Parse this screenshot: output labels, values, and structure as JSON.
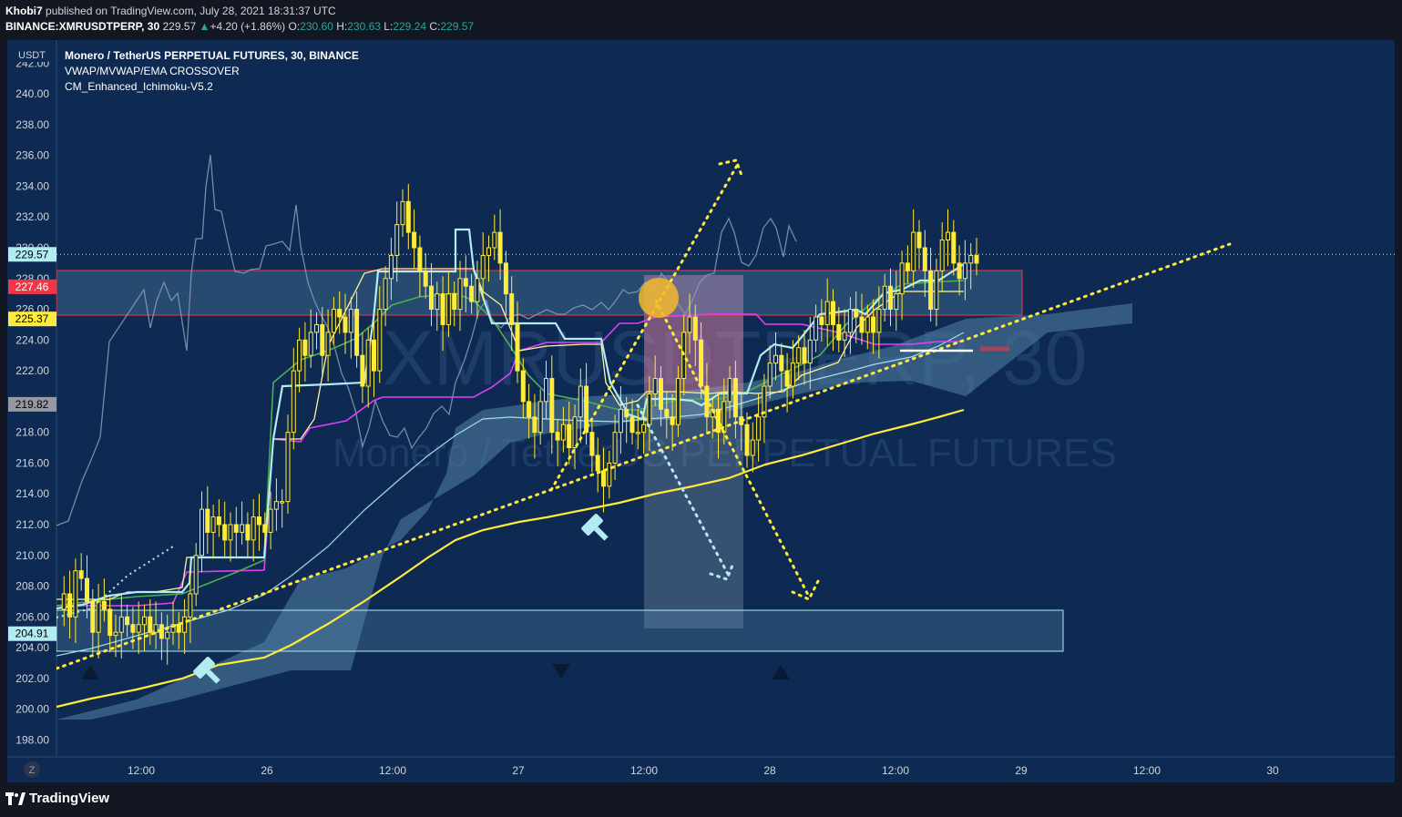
{
  "header": {
    "author": "Khobi7",
    "published_text": "published on TradingView.com, July 28, 2021 18:31:37 UTC",
    "symbol": "BINANCE:XMRUSDTPERP, 30",
    "last_price": "229.57",
    "change_arrow": "▲",
    "change": "+4.20 (+1.86%)",
    "open_label": "O:",
    "open": "230.60",
    "high_label": "H:",
    "high": "230.63",
    "low_label": "L:",
    "low": "229.24",
    "close_label": "C:",
    "close": "229.57"
  },
  "legend": {
    "title": "Monero / TetherUS PERPETUAL FUTURES, 30, BINANCE",
    "indicator_1": "VWAP/MVWAP/EMA CROSSOVER",
    "indicator_2": "CM_Enhanced_Ichimoku-V5.2"
  },
  "watermark": {
    "symbol": "XMRUSDTPERP, 30",
    "name": "Monero / TetherUS PERPETUAL FUTURES"
  },
  "price_axis": {
    "currency": "USDT",
    "tick_labels": [
      "198.00",
      "200.00",
      "202.00",
      "204.00",
      "206.00",
      "208.00",
      "210.00",
      "212.00",
      "214.00",
      "216.00",
      "218.00",
      "220.00",
      "222.00",
      "224.00",
      "226.00",
      "228.00",
      "230.00",
      "232.00",
      "234.00",
      "236.00",
      "238.00",
      "240.00",
      "242.00"
    ],
    "badges": [
      {
        "label": "229.57",
        "value": 229.57,
        "bg": "#b2ebf2",
        "fg": "#000000"
      },
      {
        "label": "227.46",
        "value": 227.46,
        "bg": "#f23645",
        "fg": "#ffffff"
      },
      {
        "label": "225.37",
        "value": 225.37,
        "bg": "#ffeb3b",
        "fg": "#000000"
      },
      {
        "label": "219.82",
        "value": 219.82,
        "bg": "#9598a1",
        "fg": "#000000"
      },
      {
        "label": "204.91",
        "value": 204.91,
        "bg": "#b2ebf2",
        "fg": "#000000"
      }
    ]
  },
  "time_axis": {
    "labels": [
      "12:00",
      "26",
      "12:00",
      "27",
      "12:00",
      "28",
      "12:00",
      "29",
      "12:00",
      "30"
    ],
    "goto_button": "Z"
  },
  "footer": {
    "brand": "TradingView"
  },
  "colors": {
    "background": "#0e2a52",
    "candle": "#ffeb3b",
    "cyan_line": "#b2ebf2",
    "green_line": "#4caf50",
    "purple_line": "#e040fb",
    "ema_yellow": "#ffeb3b",
    "cloud": "#4f7c9e",
    "zone_red": "#f23645"
  },
  "chart_data": {
    "type": "candlestick",
    "title": "Monero / TetherUS PERPETUAL FUTURES, 30, BINANCE",
    "ylabel": "USDT",
    "ylim": [
      196.9,
      243.5
    ],
    "last_price": 229.57,
    "price_path": [
      [
        0,
        206.5
      ],
      [
        6,
        207.5
      ],
      [
        12,
        206
      ],
      [
        18,
        209
      ],
      [
        24,
        208.5
      ],
      [
        30,
        207
      ],
      [
        36,
        205
      ],
      [
        42,
        207
      ],
      [
        48,
        206.5
      ],
      [
        54,
        204.8
      ],
      [
        60,
        205
      ],
      [
        66,
        206
      ],
      [
        72,
        205.5
      ],
      [
        78,
        205
      ],
      [
        84,
        205.5
      ],
      [
        90,
        206
      ],
      [
        96,
        205
      ],
      [
        102,
        205.5
      ],
      [
        108,
        204.6
      ],
      [
        114,
        205
      ],
      [
        120,
        205.5
      ],
      [
        126,
        205
      ],
      [
        132,
        206
      ],
      [
        138,
        207.5
      ],
      [
        144,
        210
      ],
      [
        150,
        213
      ],
      [
        156,
        211.5
      ],
      [
        162,
        212.5
      ],
      [
        168,
        212
      ],
      [
        174,
        211
      ],
      [
        180,
        212
      ],
      [
        186,
        211.5
      ],
      [
        192,
        212
      ],
      [
        198,
        211
      ],
      [
        204,
        212.5
      ],
      [
        210,
        212
      ],
      [
        216,
        211.5
      ],
      [
        222,
        213
      ],
      [
        228,
        213.5
      ],
      [
        234,
        213.5
      ],
      [
        240,
        218
      ],
      [
        246,
        222
      ],
      [
        252,
        224
      ],
      [
        258,
        223
      ],
      [
        264,
        224.5
      ],
      [
        270,
        225
      ],
      [
        276,
        223
      ],
      [
        282,
        224.5
      ],
      [
        288,
        226
      ],
      [
        294,
        225.5
      ],
      [
        300,
        224.5
      ],
      [
        306,
        226
      ],
      [
        312,
        223
      ],
      [
        318,
        221
      ],
      [
        324,
        224
      ],
      [
        330,
        222
      ],
      [
        336,
        226
      ],
      [
        342,
        228
      ],
      [
        348,
        229.5
      ],
      [
        354,
        231.5
      ],
      [
        360,
        233
      ],
      [
        366,
        231
      ],
      [
        372,
        230
      ],
      [
        378,
        228.5
      ],
      [
        384,
        227.5
      ],
      [
        390,
        226
      ],
      [
        396,
        227
      ],
      [
        402,
        225
      ],
      [
        408,
        227
      ],
      [
        414,
        226
      ],
      [
        420,
        228
      ],
      [
        426,
        227.5
      ],
      [
        432,
        226.5
      ],
      [
        438,
        228
      ],
      [
        444,
        229.5
      ],
      [
        450,
        230
      ],
      [
        456,
        231
      ],
      [
        462,
        229
      ],
      [
        468,
        227
      ],
      [
        474,
        225
      ],
      [
        480,
        222
      ],
      [
        486,
        220
      ],
      [
        492,
        219
      ],
      [
        498,
        218
      ],
      [
        504,
        220
      ],
      [
        510,
        221.5
      ],
      [
        516,
        218
      ],
      [
        522,
        217.5
      ],
      [
        528,
        218.5
      ],
      [
        534,
        217
      ],
      [
        540,
        219
      ],
      [
        546,
        221
      ],
      [
        552,
        218
      ],
      [
        558,
        216.5
      ],
      [
        564,
        215.5
      ],
      [
        570,
        214.5
      ],
      [
        576,
        216
      ],
      [
        582,
        218
      ],
      [
        588,
        219.5
      ],
      [
        594,
        219
      ],
      [
        600,
        218
      ],
      [
        606,
        218
      ],
      [
        612,
        218.5
      ],
      [
        618,
        220.5
      ],
      [
        624,
        221.5
      ],
      [
        630,
        219.5
      ],
      [
        636,
        219
      ],
      [
        642,
        218.5
      ],
      [
        648,
        221.5
      ],
      [
        654,
        224.5
      ],
      [
        660,
        225.5
      ],
      [
        666,
        224
      ],
      [
        672,
        221
      ],
      [
        678,
        219
      ],
      [
        684,
        219.5
      ],
      [
        690,
        218
      ],
      [
        696,
        220
      ],
      [
        702,
        221.5
      ],
      [
        708,
        219
      ],
      [
        714,
        218.5
      ],
      [
        720,
        216.5
      ],
      [
        726,
        217.5
      ],
      [
        732,
        219
      ],
      [
        738,
        221
      ],
      [
        744,
        222.5
      ],
      [
        750,
        223
      ],
      [
        756,
        222
      ],
      [
        762,
        221
      ],
      [
        768,
        222.5
      ],
      [
        774,
        223.5
      ],
      [
        780,
        222.5
      ],
      [
        786,
        224
      ],
      [
        792,
        225.5
      ],
      [
        798,
        225
      ],
      [
        804,
        226.5
      ],
      [
        810,
        225
      ],
      [
        816,
        224
      ],
      [
        822,
        224.5
      ],
      [
        828,
        226
      ],
      [
        834,
        225.5
      ],
      [
        840,
        224.5
      ],
      [
        846,
        225.5
      ],
      [
        852,
        224.5
      ],
      [
        858,
        226
      ],
      [
        864,
        227.5
      ],
      [
        870,
        226
      ],
      [
        876,
        227
      ],
      [
        882,
        229
      ],
      [
        888,
        228.5
      ],
      [
        894,
        231
      ],
      [
        900,
        230
      ],
      [
        906,
        228.5
      ],
      [
        912,
        226
      ],
      [
        918,
        228.5
      ],
      [
        924,
        230.5
      ],
      [
        930,
        231
      ],
      [
        936,
        229
      ],
      [
        942,
        228
      ],
      [
        948,
        229
      ],
      [
        954,
        229.5
      ],
      [
        960,
        229
      ]
    ]
  }
}
